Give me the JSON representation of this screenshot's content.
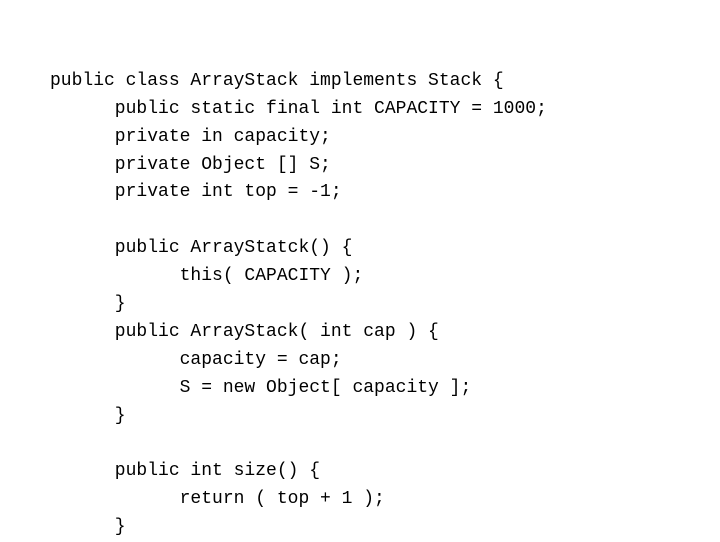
{
  "code": {
    "lines": [
      "public class ArrayStack implements Stack {",
      "      public static final int CAPACITY = 1000;",
      "      private in capacity;",
      "      private Object [] S;",
      "      private int top = -1;",
      "",
      "      public ArrayStatck() {",
      "            this( CAPACITY );",
      "      }",
      "      public ArrayStack( int cap ) {",
      "            capacity = cap;",
      "            S = new Object[ capacity ];",
      "      }",
      "",
      "      public int size() {",
      "            return ( top + 1 );",
      "      }"
    ]
  }
}
